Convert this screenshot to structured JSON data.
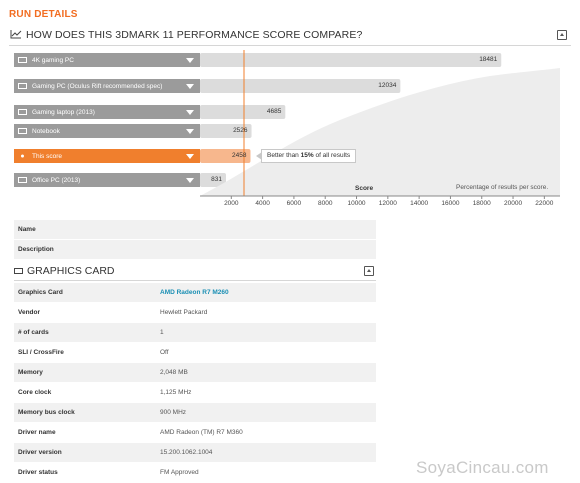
{
  "run_details_title": "RUN DETAILS",
  "compare": {
    "title": "HOW DOES THIS 3DMARK 11 PERFORMANCE SCORE COMPARE?",
    "rows": [
      {
        "label": "4K gaming PC",
        "score": "18481",
        "current": false
      },
      {
        "label": "Gaming PC (Oculus Rift recommended spec)",
        "score": "12034",
        "current": false
      },
      {
        "label": "Gaming laptop (2013)",
        "score": "4685",
        "current": false
      },
      {
        "label": "Notebook",
        "score": "2526",
        "current": false
      },
      {
        "label": "This score",
        "score": "2458",
        "current": true
      },
      {
        "label": "Office PC (2013)",
        "score": "831",
        "current": false
      }
    ],
    "tooltip": {
      "prefix": "Better than",
      "percent": "15%",
      "suffix": "of all results"
    },
    "axis_title": "Score",
    "axis_note": "Percentage of results per score.",
    "ticks": [
      "2000",
      "4000",
      "6000",
      "8000",
      "10000",
      "12000",
      "14000",
      "16000",
      "18000",
      "20000",
      "22000"
    ]
  },
  "colors": {
    "accent": "#f26d21",
    "bar_gray": "#9b9b9b",
    "link": "#1a8fb4"
  },
  "info_rows": [
    {
      "key": "Name",
      "value": ""
    },
    {
      "key": "Description",
      "value": ""
    }
  ],
  "graphics_card": {
    "title": "GRAPHICS CARD",
    "rows": [
      {
        "key": "Graphics Card",
        "value": "AMD Radeon R7 M260",
        "link": true
      },
      {
        "key": "Vendor",
        "value": "Hewlett Packard"
      },
      {
        "key": "# of cards",
        "value": "1"
      },
      {
        "key": "SLI / CrossFire",
        "value": "Off"
      },
      {
        "key": "Memory",
        "value": "2,048 MB"
      },
      {
        "key": "Core clock",
        "value": "1,125 MHz"
      },
      {
        "key": "Memory bus clock",
        "value": "900 MHz"
      },
      {
        "key": "Driver name",
        "value": "AMD Radeon (TM) R7 M360"
      },
      {
        "key": "Driver version",
        "value": "15.200.1062.1004"
      },
      {
        "key": "Driver status",
        "value": "FM Approved"
      }
    ]
  },
  "watermark": "SoyaCincau.com"
}
